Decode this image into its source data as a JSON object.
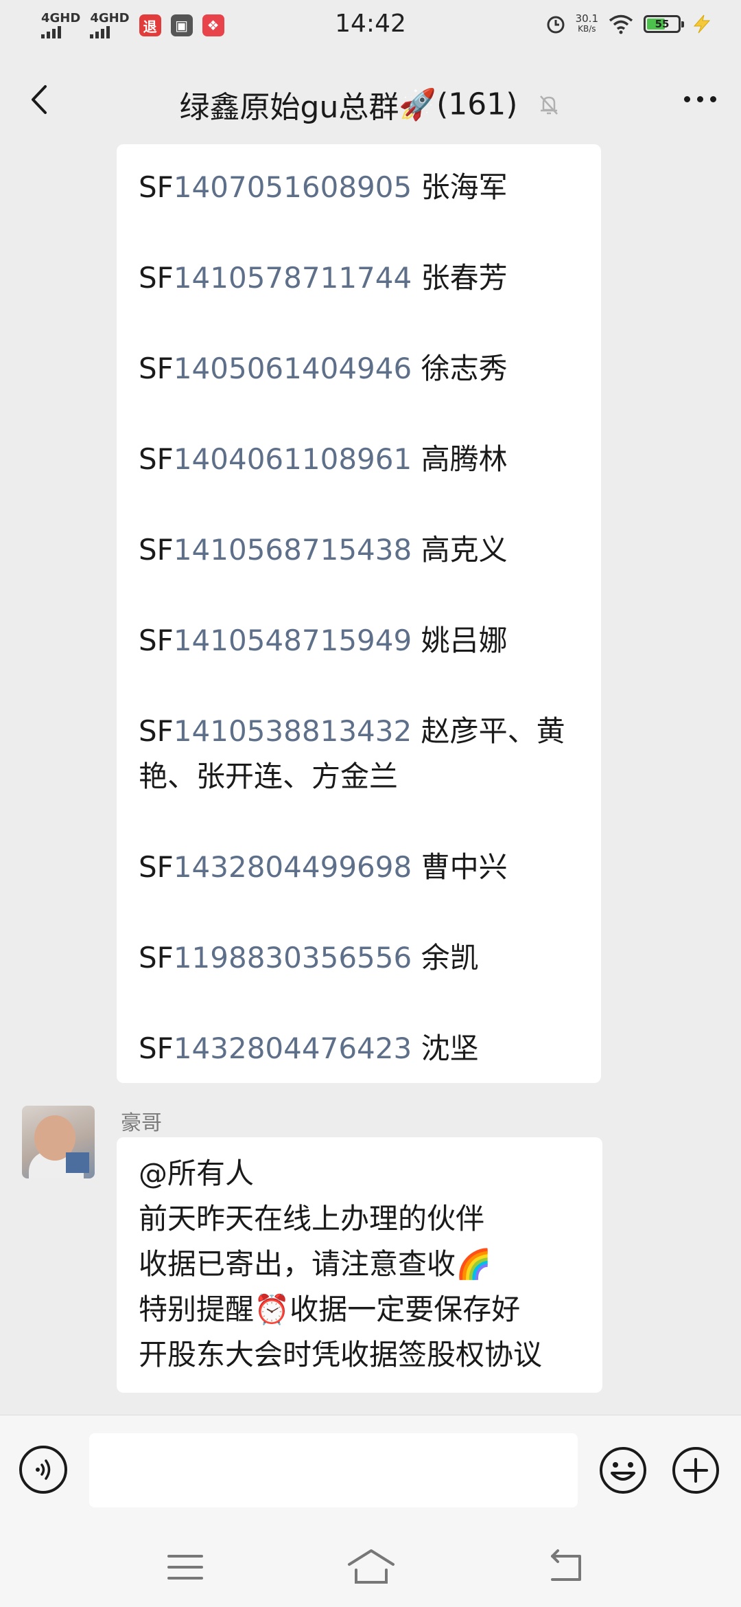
{
  "status_bar": {
    "signal1": "4GHD",
    "signal2": "4GHD",
    "time": "14:42",
    "net_speed_value": "30.1",
    "net_speed_unit": "KB/s",
    "battery_level": "55",
    "battery_color": "#4cc24c"
  },
  "header": {
    "title": "绿鑫原始gu总群",
    "title_emoji": "🚀",
    "member_count": "(161)"
  },
  "messages": [
    {
      "entries": [
        {
          "prefix": "SF",
          "number": "1407051608905",
          "names": "张海军"
        },
        {
          "prefix": "SF",
          "number": "1410578711744",
          "names": "张春芳"
        },
        {
          "prefix": "SF",
          "number": "1405061404946",
          "names": "徐志秀"
        },
        {
          "prefix": "SF",
          "number": "1404061108961",
          "names": "高腾林"
        },
        {
          "prefix": "SF",
          "number": "1410568715438",
          "names": "高克义"
        },
        {
          "prefix": "SF",
          "number": "1410548715949",
          "names": "姚吕娜"
        },
        {
          "prefix": "SF",
          "number": "1410538813432",
          "names": "赵彦平、黄",
          "names_line2": "艳、张开连、方金兰"
        },
        {
          "prefix": "SF",
          "number": "1432804499698",
          "names": "曹中兴"
        },
        {
          "prefix": "SF",
          "number": "1198830356556",
          "names": "余凯"
        },
        {
          "prefix": "SF",
          "number": "1432804476423",
          "names": "沈坚"
        }
      ]
    },
    {
      "sender": "豪哥",
      "lines": [
        "@所有人",
        "前天昨天在线上办理的伙伴",
        "收据已寄出，请注意查收🌈",
        "特别提醒⏰收据一定要保存好",
        "开股东大会时凭收据签股权协议"
      ]
    }
  ],
  "colors": {
    "background": "#ededed",
    "bubble": "#ffffff",
    "link_number": "#5e6f89"
  },
  "icons": {
    "back": "back-arrow-icon",
    "mute": "bell-off-icon",
    "more": "more-dots-icon",
    "voice": "voice-icon",
    "emoji": "emoji-icon",
    "plus": "plus-icon",
    "nav_menu": "menu-icon",
    "nav_home": "home-icon",
    "nav_back": "return-icon"
  }
}
